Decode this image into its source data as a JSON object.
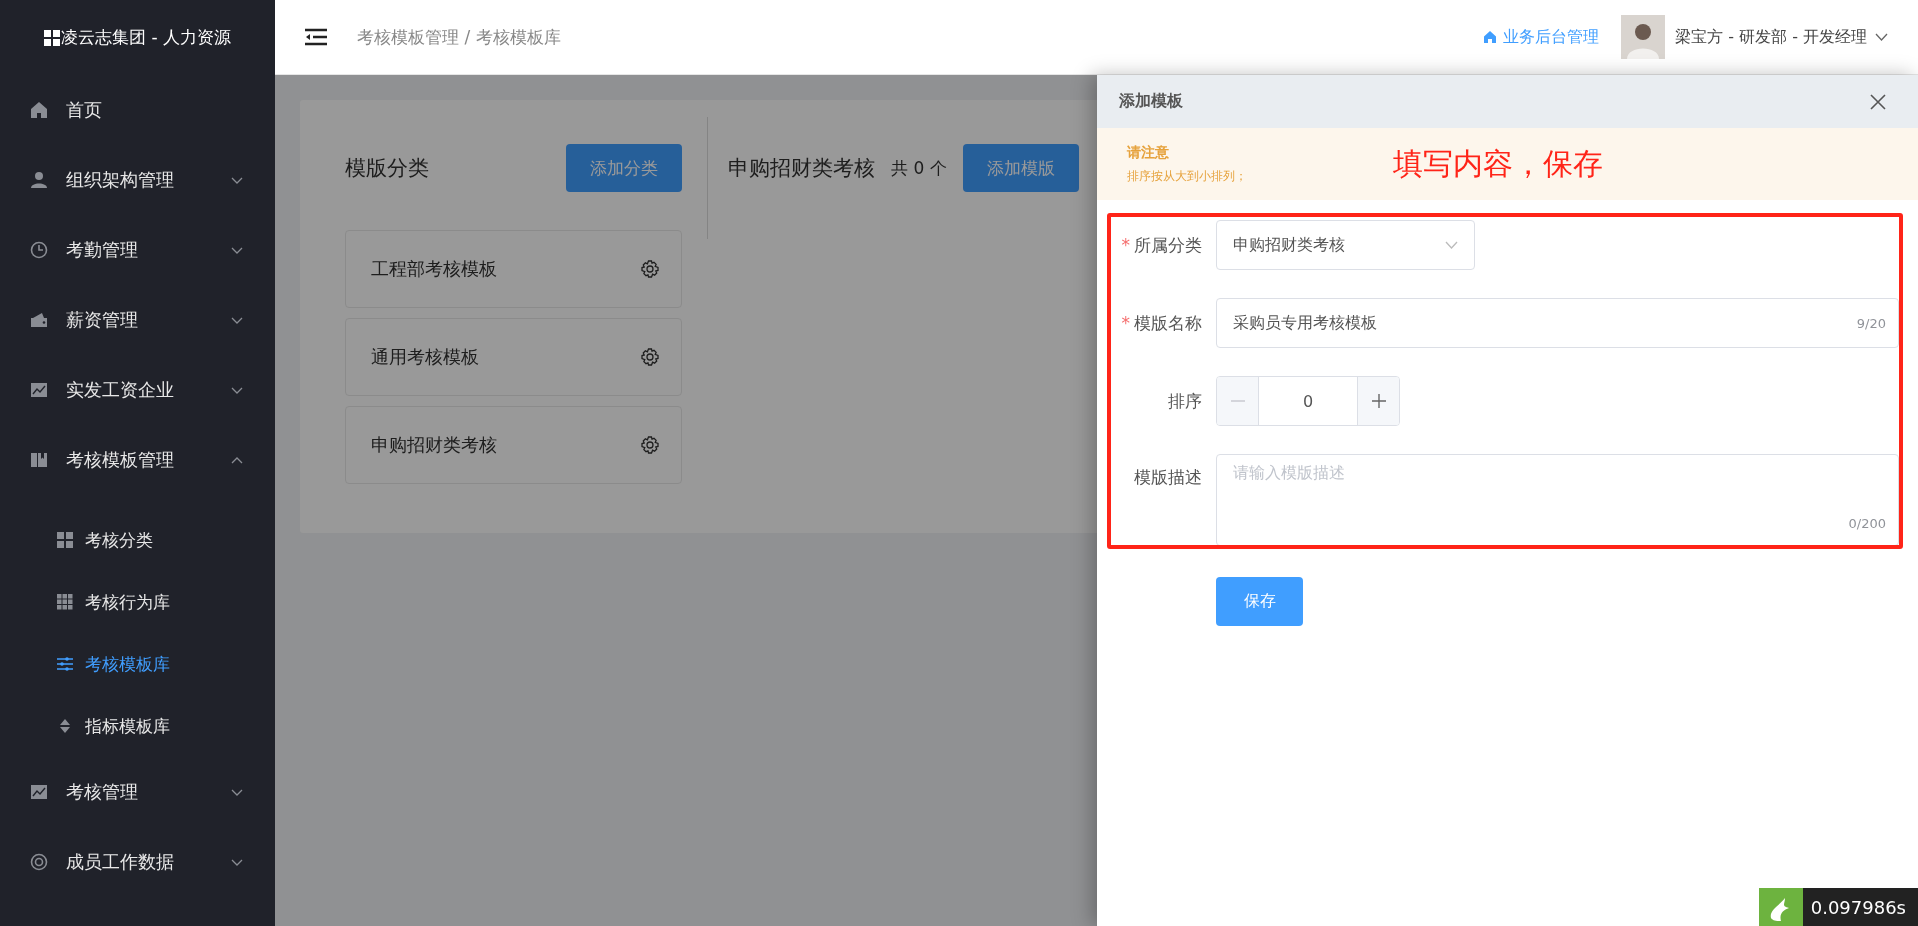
{
  "brand": {
    "title": "凌云志集团 - 人力资源"
  },
  "sidebar": {
    "items": [
      {
        "label": "首页",
        "kind": "link"
      },
      {
        "label": "组织架构管理",
        "kind": "menu",
        "expanded": false
      },
      {
        "label": "考勤管理",
        "kind": "menu",
        "expanded": false
      },
      {
        "label": "薪资管理",
        "kind": "menu",
        "expanded": false
      },
      {
        "label": "实发工资企业",
        "kind": "menu",
        "expanded": false
      },
      {
        "label": "考核模板管理",
        "kind": "menu",
        "expanded": true,
        "children": [
          {
            "label": "考核分类",
            "selected": false
          },
          {
            "label": "考核行为库",
            "selected": false
          },
          {
            "label": "考核模板库",
            "selected": true
          },
          {
            "label": "指标模板库",
            "selected": false
          }
        ]
      },
      {
        "label": "考核管理",
        "kind": "menu",
        "expanded": false
      },
      {
        "label": "成员工作数据",
        "kind": "menu",
        "expanded": false
      }
    ]
  },
  "header": {
    "breadcrumb": "考核模板管理 / 考核模板库",
    "link": "业务后台管理",
    "user": "梁宝方 - 研发部 - 开发经理"
  },
  "categories": {
    "title": "模版分类",
    "button": "添加分类",
    "items": [
      "工程部考核模板",
      "通用考核模板",
      "申购招财类考核"
    ]
  },
  "templates": {
    "title": "申购招财类考核",
    "count": "共 0 个",
    "button": "添加模版"
  },
  "drawer": {
    "title": "添加模板",
    "notice_title": "请注意",
    "notice_text": "排序按从大到小排列；",
    "annotation": "填写内容，保存",
    "fields": [
      {
        "kind": "select",
        "label": "所属分类",
        "required_mark": "*",
        "value": "申购招财类考核"
      },
      {
        "kind": "text",
        "label": "模版名称",
        "required_mark": "*",
        "value": "采购员专用考核模板",
        "counter": "9/20"
      },
      {
        "kind": "number",
        "label": "排序",
        "value": "0",
        "decrease_disabled": true
      },
      {
        "kind": "textarea",
        "label": "模版描述",
        "placeholder": "请输入模版描述",
        "counter": "0/200"
      }
    ],
    "save": "保存"
  },
  "debug": {
    "time": "0.097986s"
  }
}
